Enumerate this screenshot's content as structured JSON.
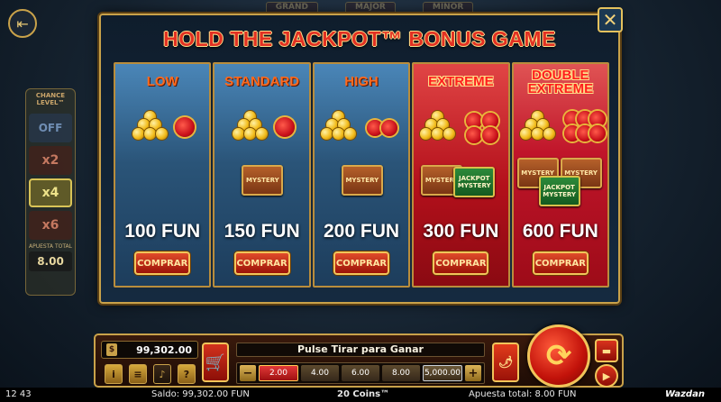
{
  "modal": {
    "title": "HOLD THE JACKPOT™ BONUS GAME",
    "close_label": "✕",
    "tiers": [
      {
        "name": "LOW",
        "price": "100 FUN",
        "buy_label": "COMPRAR",
        "mystery": [],
        "jackpot_mystery": []
      },
      {
        "name": "STANDARD",
        "price": "150 FUN",
        "buy_label": "COMPRAR",
        "mystery": [
          "MYSTERY"
        ],
        "jackpot_mystery": []
      },
      {
        "name": "HIGH",
        "price": "200 FUN",
        "buy_label": "COMPRAR",
        "mystery": [
          "MYSTERY"
        ],
        "jackpot_mystery": []
      },
      {
        "name": "EXTREME",
        "price": "300 FUN",
        "buy_label": "COMPRAR",
        "mystery": [
          "MYSTERY"
        ],
        "jackpot_mystery": [
          "JACKPOT MYSTERY"
        ]
      },
      {
        "name": "DOUBLE EXTREME",
        "price": "600 FUN",
        "buy_label": "COMPRAR",
        "mystery": [
          "MYSTERY",
          "MYSTERY"
        ],
        "jackpot_mystery": [
          "JACKPOT MYSTERY"
        ]
      }
    ]
  },
  "top_strip": {
    "labels": [
      "GRAND",
      "MAJOR",
      "MINOR"
    ]
  },
  "chance_panel": {
    "title": "CHANCE LEVEL™",
    "levels": [
      "OFF",
      "x2",
      "x4",
      "x6"
    ],
    "selected": "x4",
    "apuesta_label": "APUESTA TOTAL",
    "apuesta_value": "8.00"
  },
  "controls": {
    "balance": "99,302.00",
    "message": "Pulse Tirar para Ganar",
    "bets": [
      "2.00",
      "4.00",
      "6.00",
      "8.00",
      "5,000.00"
    ],
    "active_bet": "2.00",
    "minus": "−",
    "plus": "+",
    "info": "i",
    "menu": "≡",
    "help": "?"
  },
  "status_bar": {
    "time": "12 43",
    "saldo": "Saldo: 99,302.00 FUN",
    "coins": "20 Coins™",
    "apuesta": "Apuesta total: 8.00 FUN",
    "brand": "Wazdan"
  },
  "colors": {
    "gold": "#c9a24a",
    "title_red": "#e23123",
    "low_blue": "#2a5478",
    "extreme_red": "#b3101b"
  }
}
